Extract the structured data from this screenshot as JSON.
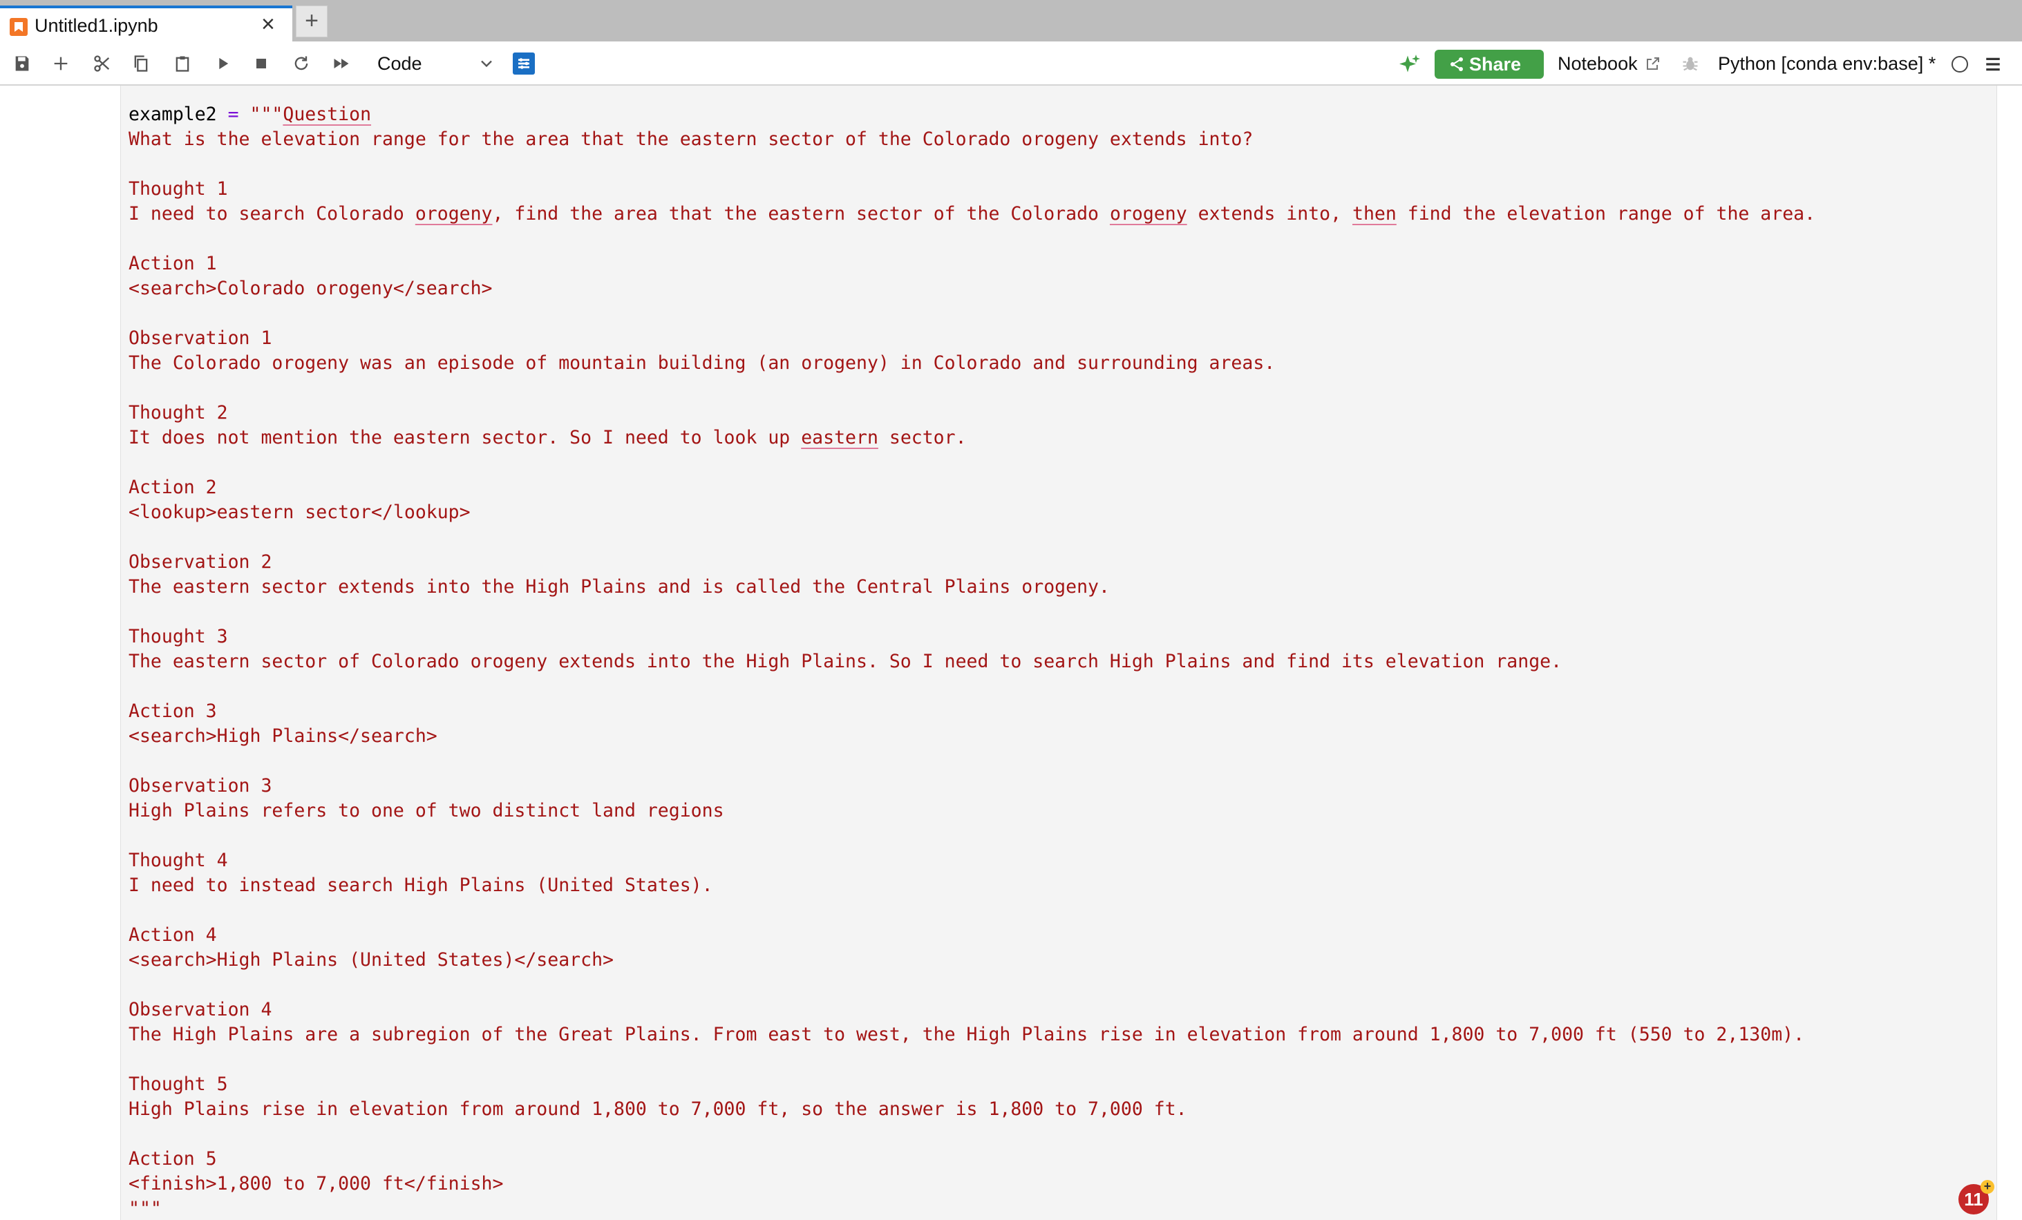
{
  "tab": {
    "title": "Untitled1.ipynb",
    "close_icon": "close-icon",
    "add_label": "+"
  },
  "toolbar": {
    "icons": [
      "save-icon",
      "add-cell-icon",
      "cut-icon",
      "copy-icon",
      "paste-icon",
      "run-icon",
      "stop-icon",
      "restart-icon",
      "run-all-icon"
    ],
    "cell_type": "Code",
    "share_label": "Share",
    "notebook_label": "Notebook",
    "kernel_label": "Python [conda env:base] *"
  },
  "code": {
    "lines": [
      {
        "type": "first",
        "var": "example2",
        "op": " = ",
        "quote": "\"\"\"",
        "rest": "Question"
      },
      {
        "text": "What is the elevation range for the area that the eastern sector of the Colorado orogeny extends into?"
      },
      {
        "text": ""
      },
      {
        "text": "Thought 1"
      },
      {
        "text": "I need to search Colorado orogeny, find the area that the eastern sector of the Colorado orogeny extends into, then find the elevation range of the area."
      },
      {
        "text": ""
      },
      {
        "text": "Action 1"
      },
      {
        "text": "<search>Colorado orogeny</search>"
      },
      {
        "text": ""
      },
      {
        "text": "Observation 1"
      },
      {
        "text": "The Colorado orogeny was an episode of mountain building (an orogeny) in Colorado and surrounding areas."
      },
      {
        "text": ""
      },
      {
        "text": "Thought 2"
      },
      {
        "text": "It does not mention the eastern sector. So I need to look up eastern sector."
      },
      {
        "text": ""
      },
      {
        "text": "Action 2"
      },
      {
        "text": "<lookup>eastern sector</lookup>"
      },
      {
        "text": ""
      },
      {
        "text": "Observation 2"
      },
      {
        "text": "The eastern sector extends into the High Plains and is called the Central Plains orogeny."
      },
      {
        "text": ""
      },
      {
        "text": "Thought 3"
      },
      {
        "text": "The eastern sector of Colorado orogeny extends into the High Plains. So I need to search High Plains and find its elevation range."
      },
      {
        "text": ""
      },
      {
        "text": "Action 3"
      },
      {
        "text": "<search>High Plains</search>"
      },
      {
        "text": ""
      },
      {
        "text": "Observation 3"
      },
      {
        "text": "High Plains refers to one of two distinct land regions"
      },
      {
        "text": ""
      },
      {
        "text": "Thought 4"
      },
      {
        "text": "I need to instead search High Plains (United States)."
      },
      {
        "text": ""
      },
      {
        "text": "Action 4"
      },
      {
        "text": "<search>High Plains (United States)</search>"
      },
      {
        "text": ""
      },
      {
        "text": "Observation 4"
      },
      {
        "text": "The High Plains are a subregion of the Great Plains. From east to west, the High Plains rise in elevation from around 1,800 to 7,000 ft (550 to 2,130m)."
      },
      {
        "text": ""
      },
      {
        "text": "Thought 5"
      },
      {
        "text": "High Plains rise in elevation from around 1,800 to 7,000 ft, so the answer is 1,800 to 7,000 ft."
      },
      {
        "text": ""
      },
      {
        "text": "Action 5"
      },
      {
        "text": "<finish>1,800 to 7,000 ft</finish>"
      },
      {
        "text": "\"\"\""
      }
    ]
  },
  "spellcheck_words": [
    "Question",
    "orogeny",
    "then",
    "eastern"
  ],
  "notification_badge": "11",
  "colors": {
    "string": "#a31515",
    "accent_blue": "#1976d2",
    "share_green": "#43a047"
  }
}
